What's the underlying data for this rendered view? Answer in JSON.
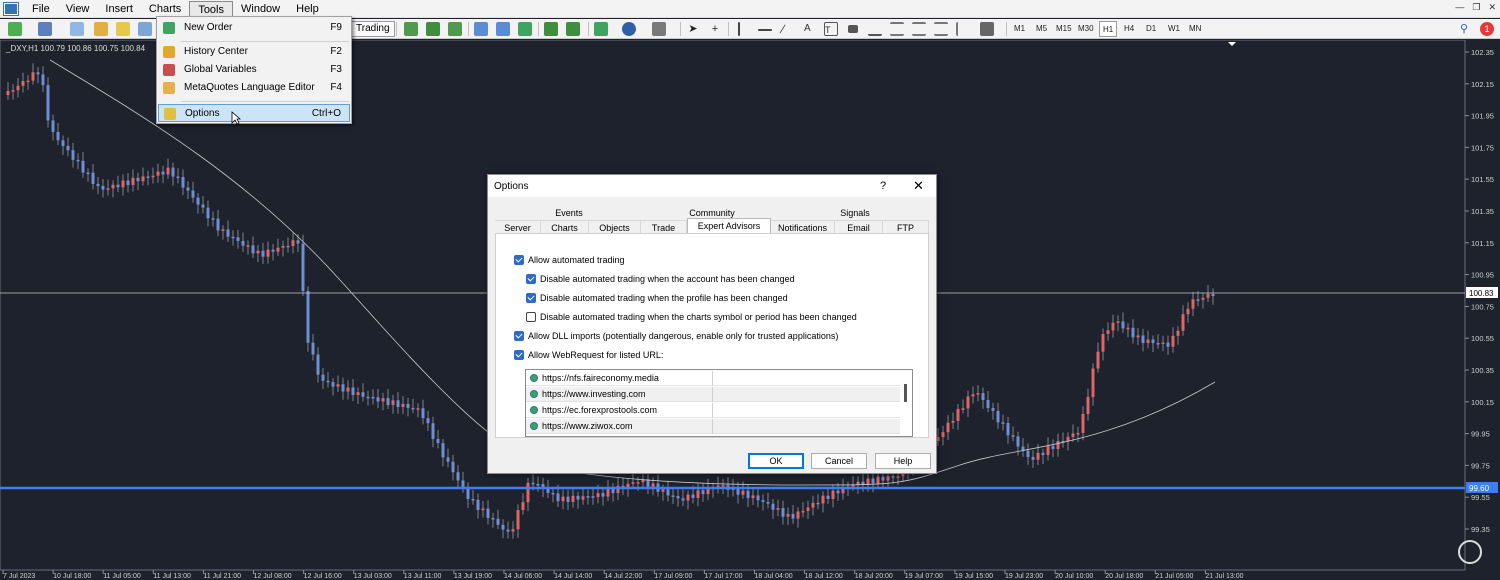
{
  "menubar": {
    "items": [
      "File",
      "View",
      "Insert",
      "Charts",
      "Tools",
      "Window",
      "Help"
    ]
  },
  "toolbar": {
    "autotrading_label": "Trading",
    "timeframes": [
      "M1",
      "M5",
      "M15",
      "M30",
      "H1",
      "H4",
      "D1",
      "W1",
      "MN"
    ],
    "selected_timeframe": "H1",
    "notification_count": "1"
  },
  "tools_menu": {
    "items": [
      {
        "label": "New Order",
        "shortcut": "F9"
      },
      {
        "label": "History Center",
        "shortcut": "F2"
      },
      {
        "label": "Global Variables",
        "shortcut": "F3"
      },
      {
        "label": "MetaQuotes Language Editor",
        "shortcut": "F4"
      },
      {
        "label": "Options",
        "shortcut": "Ctrl+O"
      }
    ]
  },
  "chart": {
    "symbol_label": "_DXY,H1  100.79 100.86 100.75 100.84",
    "price_ticks": [
      "102.35",
      "102.15",
      "101.95",
      "101.75",
      "101.55",
      "101.35",
      "101.15",
      "100.95",
      "100.75",
      "100.55",
      "100.35",
      "100.15",
      "99.95",
      "99.75",
      "99.55",
      "99.35"
    ],
    "time_ticks": [
      "7 Jul 2023",
      "10 Jul 18:00",
      "11 Jul 05:00",
      "11 Jul 13:00",
      "11 Jul 21:00",
      "12 Jul 08:00",
      "12 Jul 16:00",
      "13 Jul 03:00",
      "13 Jul 11:00",
      "13 Jul 19:00",
      "14 Jul 06:00",
      "14 Jul 14:00",
      "14 Jul 22:00",
      "17 Jul 09:00",
      "17 Jul 17:00",
      "18 Jul 04:00",
      "18 Jul 12:00",
      "18 Jul 20:00",
      "19 Jul 07:00",
      "19 Jul 15:00",
      "19 Jul 23:00",
      "20 Jul 10:00",
      "20 Jul 18:00",
      "21 Jul 05:00",
      "21 Jul 13:00"
    ],
    "current_price": "100.83",
    "hline_price": "99.60",
    "colors": {
      "bull": "#e06666",
      "bear": "#6d8fd6",
      "hline": "#3d7ef5"
    }
  },
  "dialog": {
    "title": "Options",
    "help": "?",
    "close": "✕",
    "tabs_row1": [
      "Events",
      "Community",
      "Signals"
    ],
    "tabs_row2": [
      "Server",
      "Charts",
      "Objects",
      "Trade",
      "Expert Advisors",
      "Notifications",
      "Email",
      "FTP"
    ],
    "active_tab": "Expert Advisors",
    "options": [
      {
        "label": "Allow automated trading",
        "checked": true
      },
      {
        "label": "Disable automated trading when the account has been changed",
        "checked": true
      },
      {
        "label": "Disable automated trading when the profile has been changed",
        "checked": true
      },
      {
        "label": "Disable automated trading when the charts symbol or period has been changed",
        "checked": false
      },
      {
        "label": "Allow DLL imports (potentially dangerous, enable only for trusted applications)",
        "checked": true
      },
      {
        "label": "Allow WebRequest for listed URL:",
        "checked": true
      }
    ],
    "urls": [
      "https://nfs.faireconomy.media",
      "https://www.investing.com",
      "https://ec.forexprostools.com",
      "https://www.ziwox.com"
    ],
    "buttons": {
      "ok": "OK",
      "cancel": "Cancel",
      "help": "Help"
    }
  }
}
